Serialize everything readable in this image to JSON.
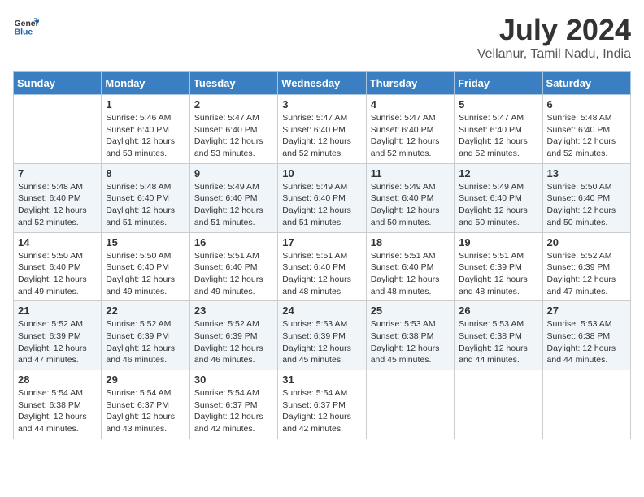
{
  "header": {
    "logo_line1": "General",
    "logo_line2": "Blue",
    "month": "July 2024",
    "location": "Vellanur, Tamil Nadu, India"
  },
  "weekdays": [
    "Sunday",
    "Monday",
    "Tuesday",
    "Wednesday",
    "Thursday",
    "Friday",
    "Saturday"
  ],
  "weeks": [
    [
      {
        "day": "",
        "empty": true
      },
      {
        "day": "1",
        "sunrise": "5:46 AM",
        "sunset": "6:40 PM",
        "daylight": "12 hours and 53 minutes."
      },
      {
        "day": "2",
        "sunrise": "5:47 AM",
        "sunset": "6:40 PM",
        "daylight": "12 hours and 53 minutes."
      },
      {
        "day": "3",
        "sunrise": "5:47 AM",
        "sunset": "6:40 PM",
        "daylight": "12 hours and 52 minutes."
      },
      {
        "day": "4",
        "sunrise": "5:47 AM",
        "sunset": "6:40 PM",
        "daylight": "12 hours and 52 minutes."
      },
      {
        "day": "5",
        "sunrise": "5:47 AM",
        "sunset": "6:40 PM",
        "daylight": "12 hours and 52 minutes."
      },
      {
        "day": "6",
        "sunrise": "5:48 AM",
        "sunset": "6:40 PM",
        "daylight": "12 hours and 52 minutes."
      }
    ],
    [
      {
        "day": "7",
        "sunrise": "5:48 AM",
        "sunset": "6:40 PM",
        "daylight": "12 hours and 52 minutes."
      },
      {
        "day": "8",
        "sunrise": "5:48 AM",
        "sunset": "6:40 PM",
        "daylight": "12 hours and 51 minutes."
      },
      {
        "day": "9",
        "sunrise": "5:49 AM",
        "sunset": "6:40 PM",
        "daylight": "12 hours and 51 minutes."
      },
      {
        "day": "10",
        "sunrise": "5:49 AM",
        "sunset": "6:40 PM",
        "daylight": "12 hours and 51 minutes."
      },
      {
        "day": "11",
        "sunrise": "5:49 AM",
        "sunset": "6:40 PM",
        "daylight": "12 hours and 50 minutes."
      },
      {
        "day": "12",
        "sunrise": "5:49 AM",
        "sunset": "6:40 PM",
        "daylight": "12 hours and 50 minutes."
      },
      {
        "day": "13",
        "sunrise": "5:50 AM",
        "sunset": "6:40 PM",
        "daylight": "12 hours and 50 minutes."
      }
    ],
    [
      {
        "day": "14",
        "sunrise": "5:50 AM",
        "sunset": "6:40 PM",
        "daylight": "12 hours and 49 minutes."
      },
      {
        "day": "15",
        "sunrise": "5:50 AM",
        "sunset": "6:40 PM",
        "daylight": "12 hours and 49 minutes."
      },
      {
        "day": "16",
        "sunrise": "5:51 AM",
        "sunset": "6:40 PM",
        "daylight": "12 hours and 49 minutes."
      },
      {
        "day": "17",
        "sunrise": "5:51 AM",
        "sunset": "6:40 PM",
        "daylight": "12 hours and 48 minutes."
      },
      {
        "day": "18",
        "sunrise": "5:51 AM",
        "sunset": "6:40 PM",
        "daylight": "12 hours and 48 minutes."
      },
      {
        "day": "19",
        "sunrise": "5:51 AM",
        "sunset": "6:39 PM",
        "daylight": "12 hours and 48 minutes."
      },
      {
        "day": "20",
        "sunrise": "5:52 AM",
        "sunset": "6:39 PM",
        "daylight": "12 hours and 47 minutes."
      }
    ],
    [
      {
        "day": "21",
        "sunrise": "5:52 AM",
        "sunset": "6:39 PM",
        "daylight": "12 hours and 47 minutes."
      },
      {
        "day": "22",
        "sunrise": "5:52 AM",
        "sunset": "6:39 PM",
        "daylight": "12 hours and 46 minutes."
      },
      {
        "day": "23",
        "sunrise": "5:52 AM",
        "sunset": "6:39 PM",
        "daylight": "12 hours and 46 minutes."
      },
      {
        "day": "24",
        "sunrise": "5:53 AM",
        "sunset": "6:39 PM",
        "daylight": "12 hours and 45 minutes."
      },
      {
        "day": "25",
        "sunrise": "5:53 AM",
        "sunset": "6:38 PM",
        "daylight": "12 hours and 45 minutes."
      },
      {
        "day": "26",
        "sunrise": "5:53 AM",
        "sunset": "6:38 PM",
        "daylight": "12 hours and 44 minutes."
      },
      {
        "day": "27",
        "sunrise": "5:53 AM",
        "sunset": "6:38 PM",
        "daylight": "12 hours and 44 minutes."
      }
    ],
    [
      {
        "day": "28",
        "sunrise": "5:54 AM",
        "sunset": "6:38 PM",
        "daylight": "12 hours and 44 minutes."
      },
      {
        "day": "29",
        "sunrise": "5:54 AM",
        "sunset": "6:37 PM",
        "daylight": "12 hours and 43 minutes."
      },
      {
        "day": "30",
        "sunrise": "5:54 AM",
        "sunset": "6:37 PM",
        "daylight": "12 hours and 42 minutes."
      },
      {
        "day": "31",
        "sunrise": "5:54 AM",
        "sunset": "6:37 PM",
        "daylight": "12 hours and 42 minutes."
      },
      {
        "day": "",
        "empty": true
      },
      {
        "day": "",
        "empty": true
      },
      {
        "day": "",
        "empty": true
      }
    ]
  ]
}
